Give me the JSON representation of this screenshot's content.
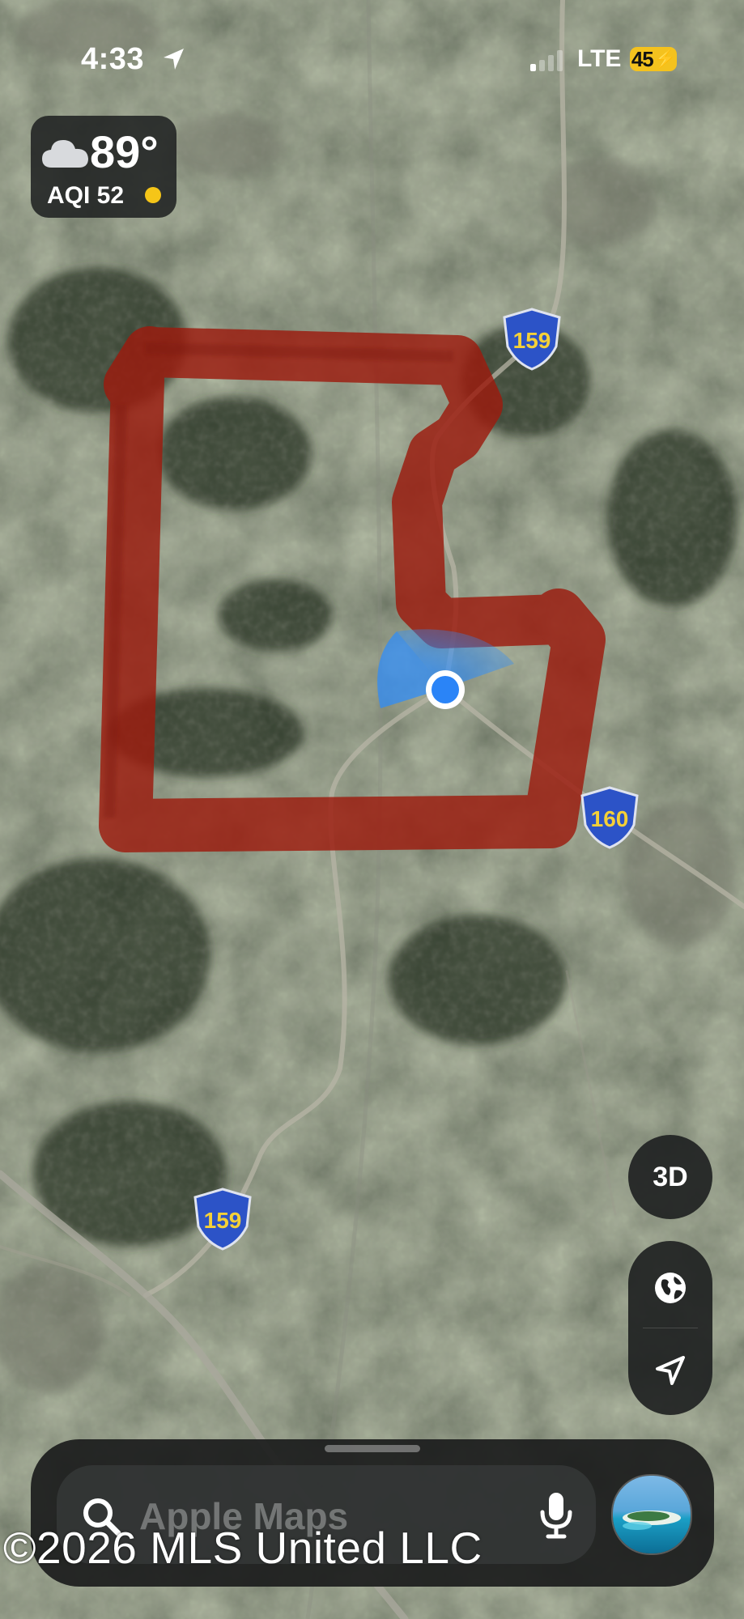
{
  "status_bar": {
    "time": "4:33",
    "network": "LTE",
    "battery": "45",
    "signal_bars_active": 1,
    "signal_bars_total": 4
  },
  "weather": {
    "temperature": "89°",
    "aqi_label": "AQI 52",
    "icon": "cloud-icon",
    "aqi_dot_color": "#f5c518"
  },
  "map": {
    "type": "satellite",
    "route_shields": [
      "159",
      "160",
      "159"
    ],
    "boundary_color": "#9c1b0e",
    "shield_color": "#2c53c7",
    "shield_text_color": "#f4d038",
    "location_color": "#2a84f7"
  },
  "controls": {
    "view_3d_label": "3D",
    "globe_icon": "globe-icon",
    "locate_icon": "location-arrow-icon"
  },
  "search": {
    "placeholder": "Apple Maps",
    "search_icon": "search-icon",
    "mic_icon": "microphone-icon"
  },
  "watermark": "©2026 MLS United LLC"
}
